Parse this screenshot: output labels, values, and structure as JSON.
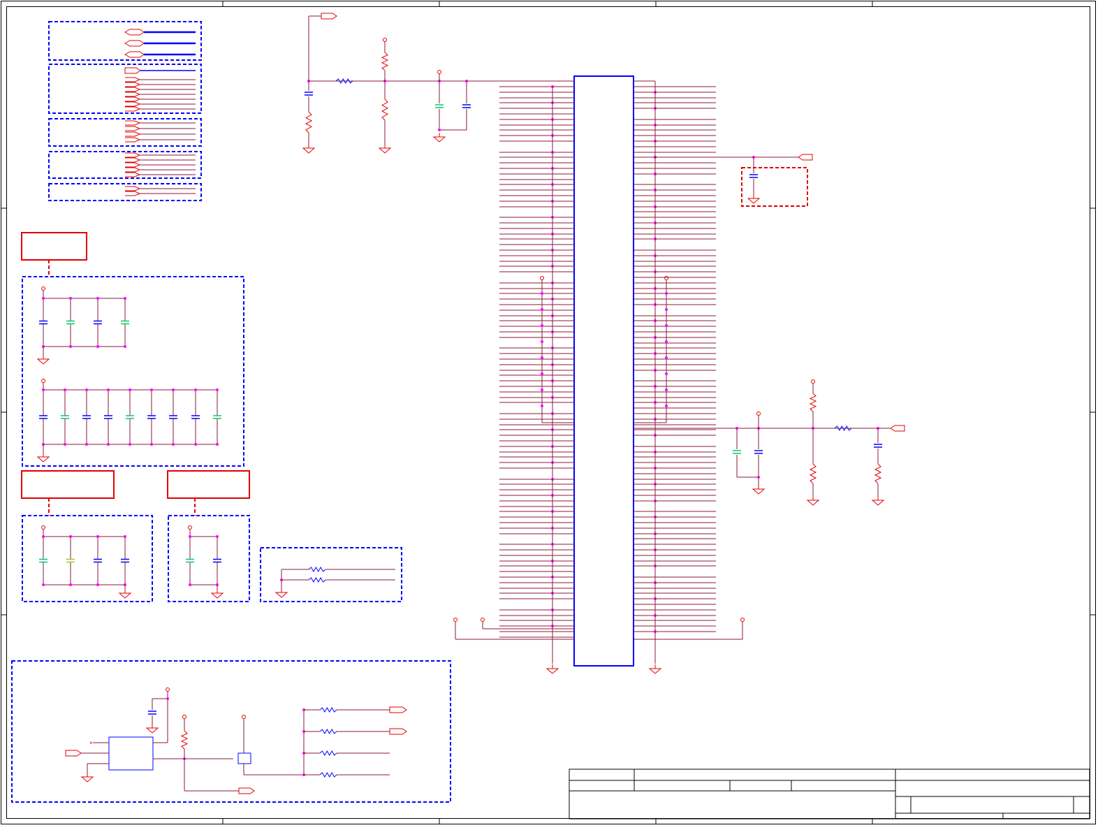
{
  "document": {
    "kind": "schematic-sheet",
    "visible_text": []
  },
  "colors": {
    "wire": "#8b1a3a",
    "component": "#e00000",
    "block_outline": "#0000ff",
    "junction": "#ff00ff",
    "cap_highlight": "#00cc66",
    "frame": "#000000"
  },
  "title_block": {
    "fields": []
  }
}
